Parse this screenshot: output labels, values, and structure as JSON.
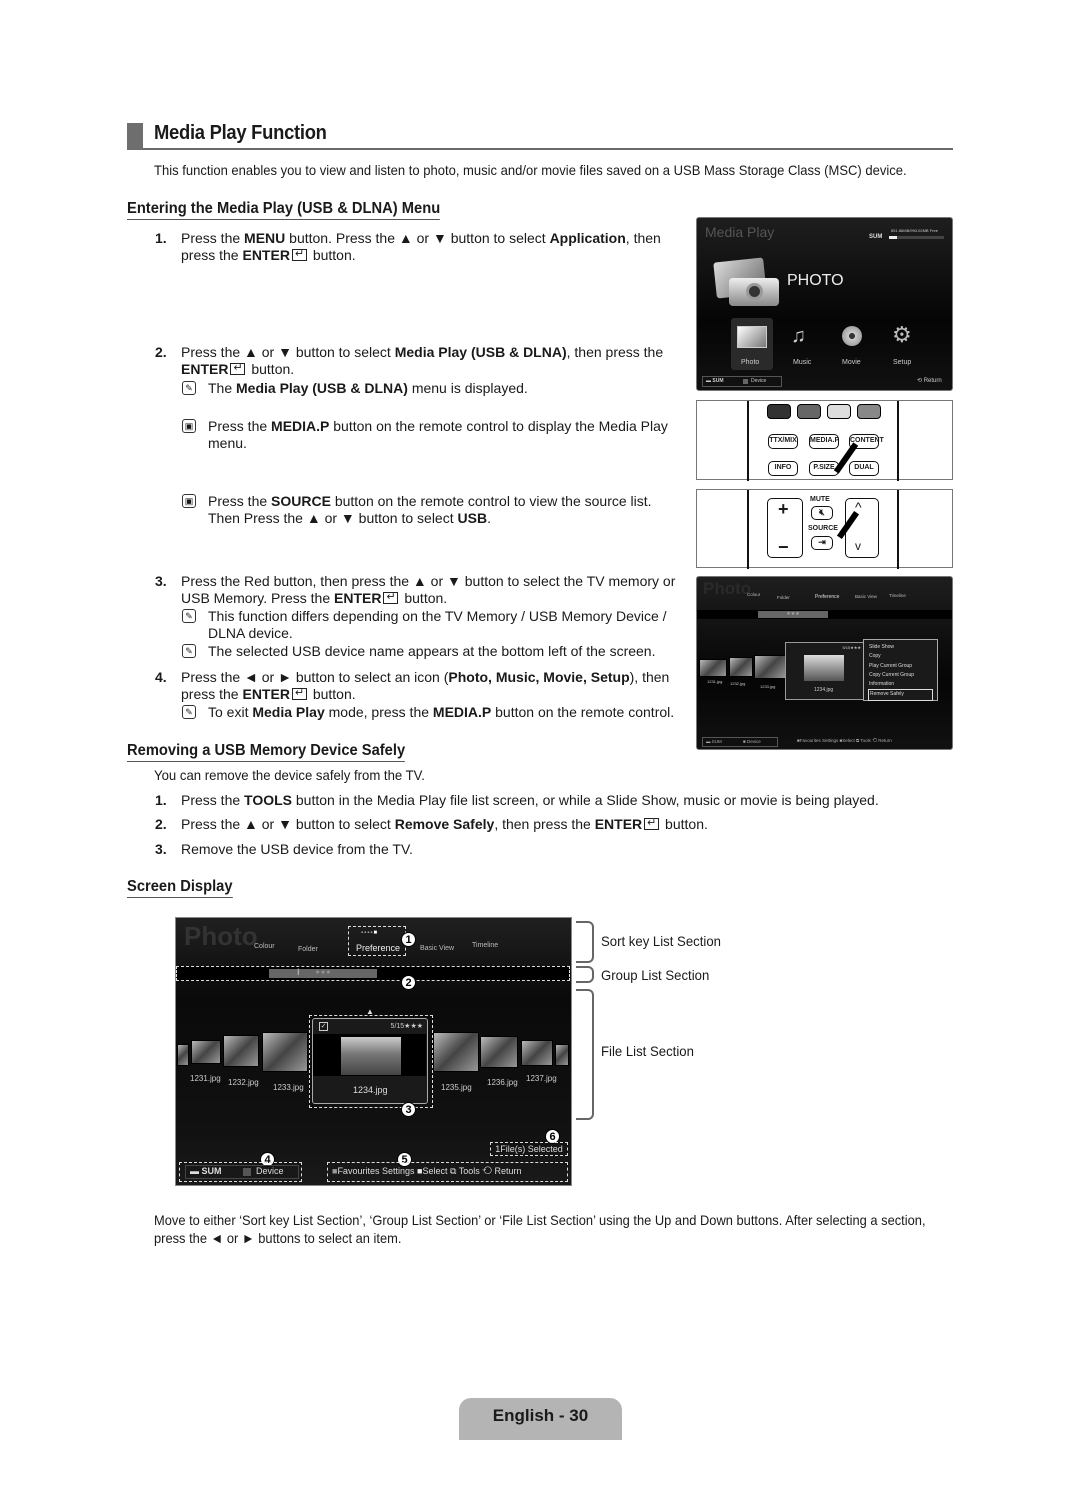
{
  "page_title": "Media Play Function",
  "intro": "This function enables you to view and listen to photo, music and/or movie files saved on a USB Mass Storage Class (MSC) device.",
  "section_entering": {
    "heading": "Entering the Media Play (USB & DLNA) Menu",
    "steps": [
      {
        "num": "1.",
        "parts": [
          "Press the ",
          "MENU",
          " button. Press the ▲ or ▼ button to select ",
          "Application",
          ", then press the ",
          "ENTER",
          " button."
        ]
      },
      {
        "num": "2.",
        "parts": [
          "Press the ▲ or ▼ button to select ",
          "Media Play (USB & DLNA)",
          ", then press the ",
          "ENTER",
          " button."
        ]
      },
      {
        "num": "3.",
        "parts": [
          "Press the Red button, then press the ▲ or ▼ button to select the TV memory or USB Memory. Press the ",
          "ENTER",
          " button."
        ]
      },
      {
        "num": "4.",
        "parts": [
          "Press the ◄ or ► button to select an icon (",
          "Photo, Music, Movie, Setup",
          "), then press the ",
          "ENTER",
          " button."
        ]
      }
    ],
    "notes": {
      "step2_note": [
        "The ",
        "Media Play (USB & DLNA)",
        " menu is displayed."
      ],
      "remote_note_1": [
        "Press the ",
        "MEDIA.P",
        " button on the remote control to display the Media Play menu."
      ],
      "remote_note_2": [
        "Press the ",
        "SOURCE",
        " button on the remote control to view the source list. Then Press the ▲ or ▼ button to select ",
        "USB",
        "."
      ],
      "step3_note_1": "This function differs depending on the TV Memory / USB Memory Device / DLNA device.",
      "step3_note_2": "The selected USB device name appears at the bottom left of the screen.",
      "step4_note": [
        "To exit ",
        "Media Play",
        " mode, press the ",
        "MEDIA.P",
        " button on the remote control."
      ]
    }
  },
  "media_play_screen": {
    "title": "Media Play",
    "device": "SUM",
    "storage": "851.86MB/993.02MB Free",
    "storage_used_fraction": 0.14,
    "category_title": "PHOTO",
    "icons": [
      {
        "label": "Photo",
        "icon": "photo-icon"
      },
      {
        "label": "Music",
        "icon": "music-icon"
      },
      {
        "label": "Movie",
        "icon": "movie-icon"
      },
      {
        "label": "Setup",
        "icon": "setup-icon"
      }
    ],
    "footer_device_label": "SUM",
    "footer_device_button": "Device",
    "footer_return": "Return"
  },
  "remote_top": {
    "buttons": [
      "TTX/MIX",
      "MEDIA.P",
      "CONTENT",
      "INFO",
      "P.SIZE",
      "DUAL"
    ]
  },
  "remote_bottom": {
    "mute": "MUTE",
    "source": "SOURCE"
  },
  "tools_screen": {
    "title": "Photo",
    "sort_keys": [
      "Colour",
      "Folder",
      "Preference",
      "Basic View",
      "Timeline"
    ],
    "group": "★★★",
    "files": [
      "1231.jpg",
      "1232.jpg",
      "1233.jpg",
      "1234.jpg"
    ],
    "counter": "5/15★★★",
    "menu": [
      "Slide Show",
      "Copy",
      "Play Current Group",
      "Copy Current Group",
      "Information",
      "Remove Safely"
    ],
    "selected_menu": "Remove Safely",
    "footer": {
      "device": "SUM",
      "device_btn": "Device",
      "fav": "Favourites Settings",
      "select": "Select",
      "tools": "Tools",
      "return": "Return"
    }
  },
  "section_removing": {
    "heading": "Removing a USB Memory Device Safely",
    "intro": "You can remove the device safely from the TV.",
    "steps": [
      {
        "num": "1.",
        "parts": [
          "Press the ",
          "TOOLS",
          " button in the Media Play file list screen, or while a Slide Show, music or movie is being played."
        ]
      },
      {
        "num": "2.",
        "parts": [
          "Press the ▲ or ▼ button to select ",
          "Remove Safely",
          ", then press the ",
          "ENTER",
          " button."
        ]
      },
      {
        "num": "3.",
        "parts": [
          "Remove the USB device from the TV."
        ]
      }
    ]
  },
  "section_screen": {
    "heading": "Screen Display",
    "screen": {
      "title": "Photo",
      "sort_keys": [
        "Colour",
        "Folder",
        "Preference",
        "Basic View",
        "Timeline"
      ],
      "group": "★★★",
      "files": [
        "1231.jpg",
        "1232.jpg",
        "1233.jpg",
        "1234.jpg",
        "1235.jpg",
        "1236.jpg",
        "1237.jpg"
      ],
      "counter": "5/15★★★",
      "selected_info": "1File(s) Selected",
      "footer": {
        "device": "SUM",
        "device_btn": "Device",
        "fav": "Favourites Settings",
        "select": "Select",
        "tools": "Tools",
        "return": "Return"
      },
      "badges": [
        "1",
        "2",
        "3",
        "4",
        "5",
        "6"
      ]
    },
    "labels": [
      "Sort key List Section",
      "Group List Section",
      "File List Section"
    ],
    "description": "Move to either ‘Sort key List Section’, ‘Group List Section’ or ‘File List Section’ using the Up and Down buttons. After selecting a section, press the ◄ or ► buttons to select an item."
  },
  "footer": "English - 30"
}
